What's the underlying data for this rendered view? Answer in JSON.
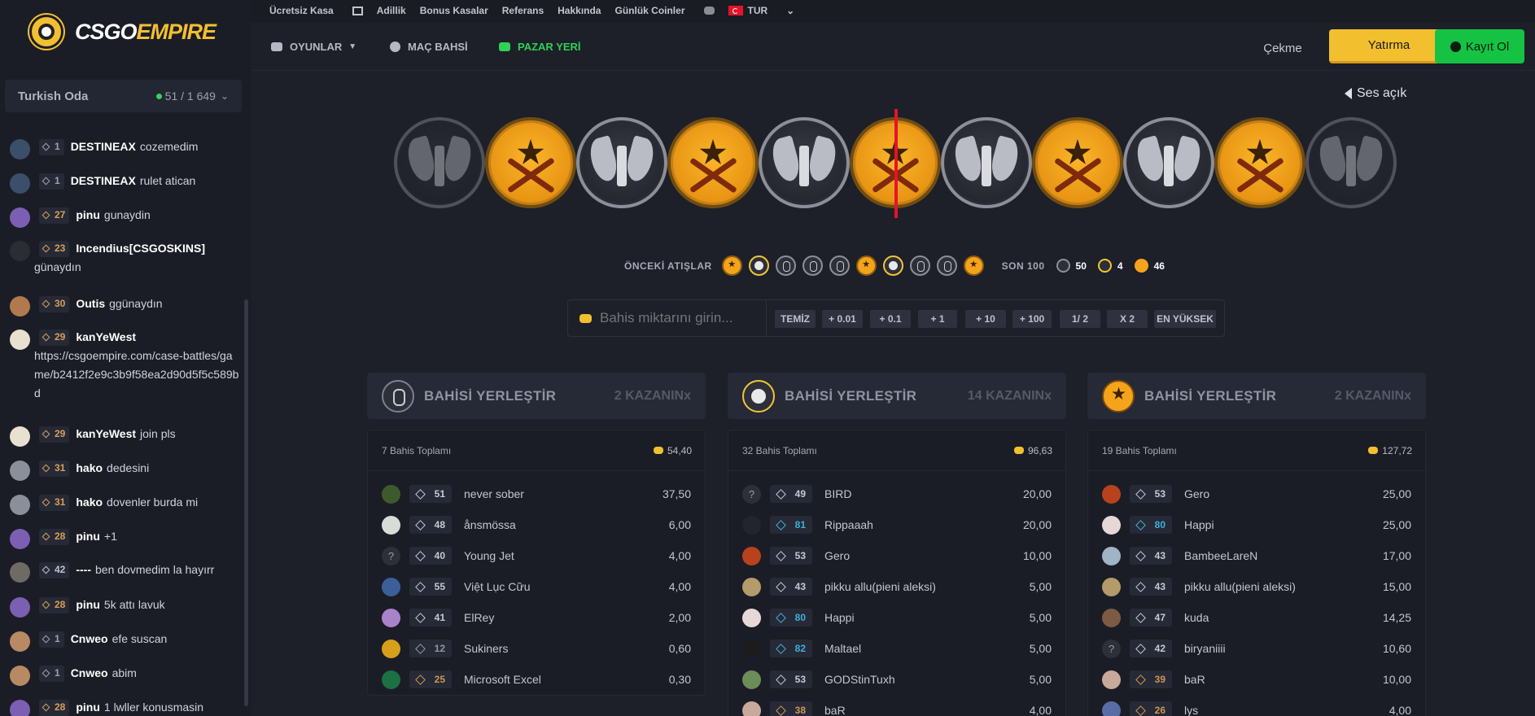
{
  "logo": {
    "part1": "CSGO",
    "part2": "EMPIRE"
  },
  "room": {
    "name": "Turkish Oda",
    "count": "51 / 1 649"
  },
  "chat": [
    {
      "level": "1",
      "user": "DESTINEAX",
      "text": "cozemedim",
      "lvl": "lv1",
      "av": "#3b4f6b"
    },
    {
      "level": "1",
      "user": "DESTINEAX",
      "text": "rulet atican",
      "lvl": "lv1",
      "av": "#3b4f6b"
    },
    {
      "level": "27",
      "user": "pinu",
      "text": "gunaydin",
      "lvl": "lvo",
      "av": "#7a5fb3"
    },
    {
      "level": "23",
      "user": "Incendius[CSGOSKINS]",
      "text": "",
      "cont": "günaydın",
      "lvl": "lvo",
      "av": "#2a2d33"
    },
    {
      "level": "30",
      "user": "Outis",
      "text": "ggünaydın",
      "lvl": "lvo",
      "av": "#b17a4e"
    },
    {
      "level": "29",
      "user": "kanYeWest",
      "text": "",
      "cont": "https://csgoempire.com/case-battles/game/b2412f2e9c3b9f58ea2d90d5f5c589bd",
      "lvl": "lvo",
      "av": "#e8e1d0"
    },
    {
      "level": "29",
      "user": "kanYeWest",
      "text": "join pls",
      "lvl": "lvo",
      "av": "#e8e1d0"
    },
    {
      "level": "31",
      "user": "hako",
      "text": "dedesini",
      "lvl": "lvo",
      "av": "#8a8f9a"
    },
    {
      "level": "31",
      "user": "hako",
      "text": "dovenler burda mi",
      "lvl": "lvo",
      "av": "#8a8f9a"
    },
    {
      "level": "28",
      "user": "pinu",
      "text": "+1",
      "lvl": "lvo",
      "av": "#7a5fb3"
    },
    {
      "level": "42",
      "user": "----",
      "text": "ben dovmedim la hayırr",
      "lvl": "lvw",
      "av": "#6e6a64"
    },
    {
      "level": "28",
      "user": "pinu",
      "text": "5k attı lavuk",
      "lvl": "lvo",
      "av": "#7a5fb3"
    },
    {
      "level": "1",
      "user": "Cnweo",
      "text": "efe suscan",
      "lvl": "lv1",
      "av": "#b78a64"
    },
    {
      "level": "1",
      "user": "Cnweo",
      "text": "abim",
      "lvl": "lv1",
      "av": "#b78a64"
    },
    {
      "level": "28",
      "user": "pinu",
      "text": "1 lwller konusmasin",
      "lvl": "lvo",
      "av": "#7a5fb3"
    }
  ],
  "toplinks": [
    "Ücretsiz Kasa",
    "Adillik",
    "Bonus Kasalar",
    "Referans",
    "Hakkında",
    "Günlük Coinler",
    "TUR"
  ],
  "nav": {
    "games": "OYUNLAR",
    "match": "MAÇ BAHSİ",
    "market": "PAZAR YERİ"
  },
  "buttons": {
    "withdraw": "Çekme",
    "deposit": "Yatırma",
    "register": "Kayıt Ol"
  },
  "sound": "Ses açık",
  "roulette": [
    "ct",
    "t",
    "ct",
    "t",
    "ct",
    "t",
    "ct",
    "t",
    "ct",
    "t",
    "ct"
  ],
  "previous": {
    "label": "ÖNCEKİ ATIŞLAR",
    "rolls": [
      "t",
      "b",
      "ct",
      "ct",
      "ct",
      "t",
      "b",
      "ct",
      "ct",
      "t"
    ]
  },
  "last100": {
    "label": "SON 100",
    "ct": "50",
    "bonus": "4",
    "t": "46"
  },
  "betinput": {
    "placeholder": "Bahis miktarını girin..."
  },
  "quickbuttons": [
    "TEMİZ",
    "+ 0.01",
    "+ 0.1",
    "+ 1",
    "+ 10",
    "+ 100",
    "1/ 2",
    "X 2",
    "EN YÜKSEK"
  ],
  "colors": {
    "accent": "#f2bf2f",
    "green": "#15c244",
    "indicator": "#e3142b"
  },
  "columns": [
    {
      "icon": "ct",
      "title": "BAHİSİ YERLEŞTİR",
      "win": "2 KAZANINx",
      "total_label": "7 Bahis Toplamı",
      "total": "54,40",
      "rows": [
        {
          "lvl": "51",
          "c": "c-white",
          "name": "never sober",
          "amt": "37,50",
          "av": "#3e5a2c"
        },
        {
          "lvl": "48",
          "c": "c-white",
          "name": "ånsmössa",
          "amt": "6,00",
          "av": "#d8dcd6"
        },
        {
          "lvl": "40",
          "c": "c-white",
          "name": "Young Jet",
          "amt": "4,00",
          "av": "#2d3039",
          "q": true
        },
        {
          "lvl": "55",
          "c": "c-white",
          "name": "Việt Lục Cữu",
          "amt": "4,00",
          "av": "#3c5f9a"
        },
        {
          "lvl": "41",
          "c": "c-white",
          "name": "ElRey",
          "amt": "2,00",
          "av": "#a983c9"
        },
        {
          "lvl": "12",
          "c": "c-gray",
          "name": "Sukiners",
          "amt": "0,60",
          "av": "#d6a01c"
        },
        {
          "lvl": "25",
          "c": "c-orange",
          "name": "Microsoft Excel",
          "amt": "0,30",
          "av": "#1d7044"
        }
      ]
    },
    {
      "icon": "b",
      "title": "BAHİSİ YERLEŞTİR",
      "win": "14 KAZANINx",
      "total_label": "32 Bahis Toplamı",
      "total": "96,63",
      "rows": [
        {
          "lvl": "49",
          "c": "c-white",
          "name": "BIRD",
          "amt": "20,00",
          "av": "#2d3039",
          "q": true
        },
        {
          "lvl": "81",
          "c": "c-blue",
          "name": "Rippaaah",
          "amt": "20,00",
          "av": "#22252b"
        },
        {
          "lvl": "53",
          "c": "c-white",
          "name": "Gero",
          "amt": "10,00",
          "av": "#b8421c"
        },
        {
          "lvl": "43",
          "c": "c-white",
          "name": "pikku allu(pieni aleksi)",
          "amt": "5,00",
          "av": "#b59a6a"
        },
        {
          "lvl": "80",
          "c": "c-blue",
          "name": "Happi",
          "amt": "5,00",
          "av": "#e7d7d7"
        },
        {
          "lvl": "82",
          "c": "c-blue",
          "name": "Maltael",
          "amt": "5,00",
          "av": "#1c1c1c"
        },
        {
          "lvl": "53",
          "c": "c-white",
          "name": "GODStinTuxh",
          "amt": "5,00",
          "av": "#6c8c59"
        },
        {
          "lvl": "38",
          "c": "c-orange",
          "name": "baR",
          "amt": "4,00",
          "av": "#c8a99b"
        }
      ]
    },
    {
      "icon": "t",
      "title": "BAHİSİ YERLEŞTİR",
      "win": "2 KAZANINx",
      "total_label": "19 Bahis Toplamı",
      "total": "127,72",
      "rows": [
        {
          "lvl": "53",
          "c": "c-white",
          "name": "Gero",
          "amt": "25,00",
          "av": "#b8421c"
        },
        {
          "lvl": "80",
          "c": "c-blue",
          "name": "Happi",
          "amt": "25,00",
          "av": "#e7d7d7"
        },
        {
          "lvl": "43",
          "c": "c-white",
          "name": "BambeeLareN",
          "amt": "17,00",
          "av": "#a0b4c6"
        },
        {
          "lvl": "43",
          "c": "c-white",
          "name": "pikku allu(pieni aleksi)",
          "amt": "15,00",
          "av": "#b59a6a"
        },
        {
          "lvl": "47",
          "c": "c-white",
          "name": "kuda",
          "amt": "14,25",
          "av": "#7d5a44"
        },
        {
          "lvl": "42",
          "c": "c-white",
          "name": "biryaniiii",
          "amt": "10,60",
          "av": "#2d3039",
          "q": true
        },
        {
          "lvl": "39",
          "c": "c-orange",
          "name": "baR",
          "amt": "10,00",
          "av": "#c8a99b"
        },
        {
          "lvl": "26",
          "c": "c-orange",
          "name": "lys",
          "amt": "4,00",
          "av": "#5a6ca6"
        }
      ]
    }
  ]
}
